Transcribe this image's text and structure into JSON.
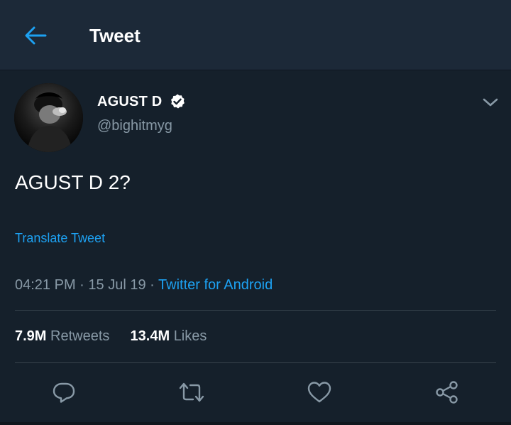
{
  "header": {
    "title": "Tweet",
    "back_icon": "arrow-left-icon"
  },
  "author": {
    "display_name": "AGUST D",
    "handle": "@bighitmyg",
    "verified": true
  },
  "tweet": {
    "text": "AGUST D 2?",
    "translate_label": "Translate Tweet",
    "time": "04:21 PM",
    "date": "15 Jul 19",
    "separator": "·",
    "source": "Twitter for Android"
  },
  "stats": {
    "retweets_count": "7.9M",
    "retweets_label": "Retweets",
    "likes_count": "13.4M",
    "likes_label": "Likes"
  },
  "actions": [
    {
      "name": "reply",
      "icon": "reply-icon"
    },
    {
      "name": "retweet",
      "icon": "retweet-icon"
    },
    {
      "name": "like",
      "icon": "heart-icon"
    },
    {
      "name": "share",
      "icon": "share-icon"
    }
  ],
  "colors": {
    "background": "#15202b",
    "header": "#1c2938",
    "accent": "#1da1f2",
    "secondary_text": "#8899a6",
    "divider": "#38444d"
  }
}
